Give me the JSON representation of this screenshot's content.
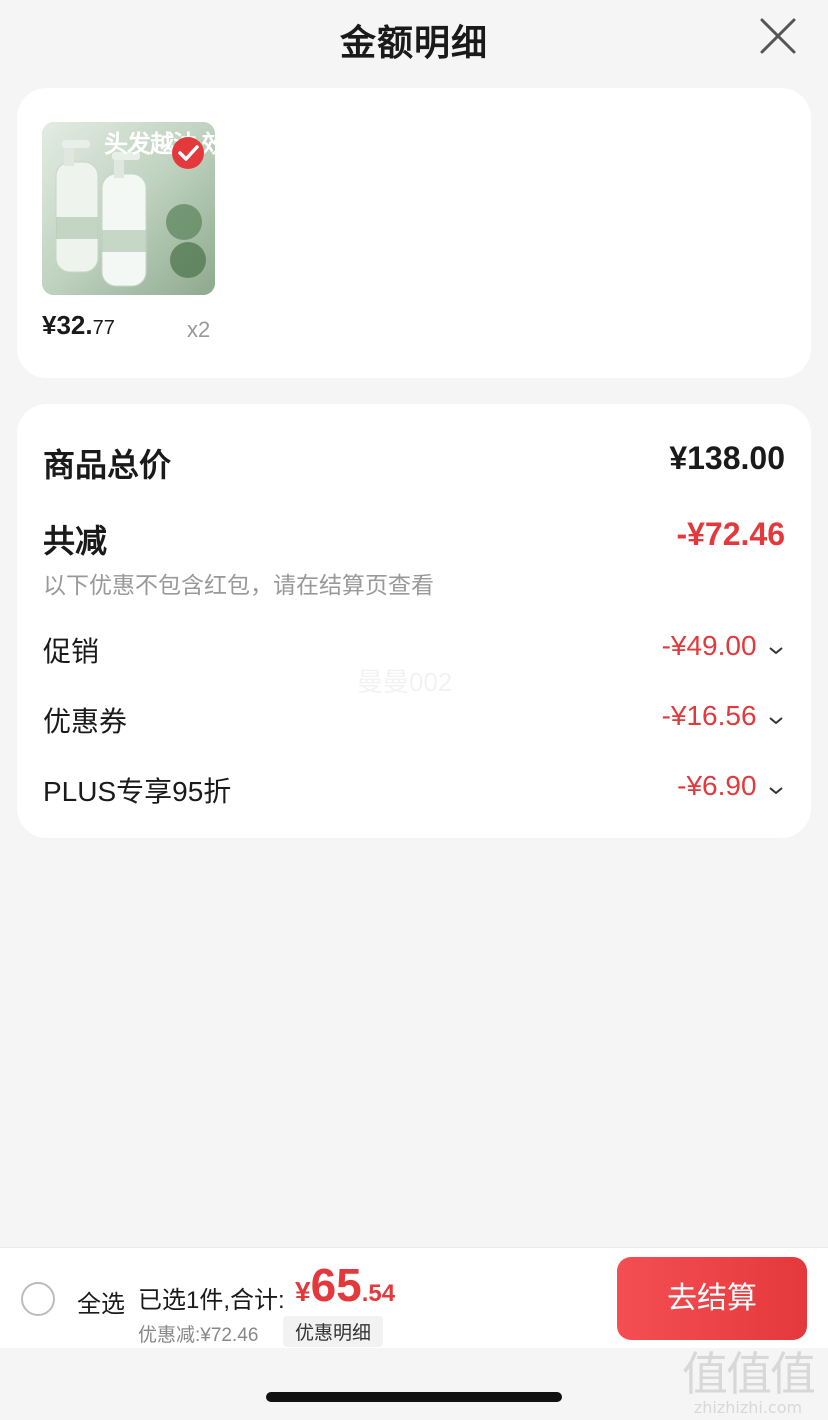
{
  "header": {
    "title": "金额明细"
  },
  "product": {
    "image_text": "头发越油 效果越好",
    "price_main": "¥32.",
    "price_cents": "77",
    "quantity": "x2"
  },
  "summary": {
    "total_label": "商品总价",
    "total_value": "¥138.00",
    "reduce_label": "共减",
    "reduce_value": "-¥72.46",
    "note": "以下优惠不包含红包，请在结算页查看",
    "items": [
      {
        "label": "促销",
        "value": "-¥49.00"
      },
      {
        "label": "优惠券",
        "value": "-¥16.56"
      },
      {
        "label": "PLUS专享95折",
        "value": "-¥6.90"
      }
    ],
    "watermark": "曼曼002"
  },
  "bottom_bar": {
    "select_all_label": "全选",
    "selected_info": "已选1件,合计:",
    "total_currency": "¥",
    "total_main": "65",
    "total_cents": ".54",
    "discount_label": "优惠减:¥72.46",
    "detail_button": "优惠明细",
    "checkout_button": "去结算"
  },
  "site_mark": {
    "glyphs": "值值值",
    "url": "zhizhizhi.com"
  },
  "colors": {
    "accent_red": "#e4393c",
    "background": "#f5f5f5"
  }
}
